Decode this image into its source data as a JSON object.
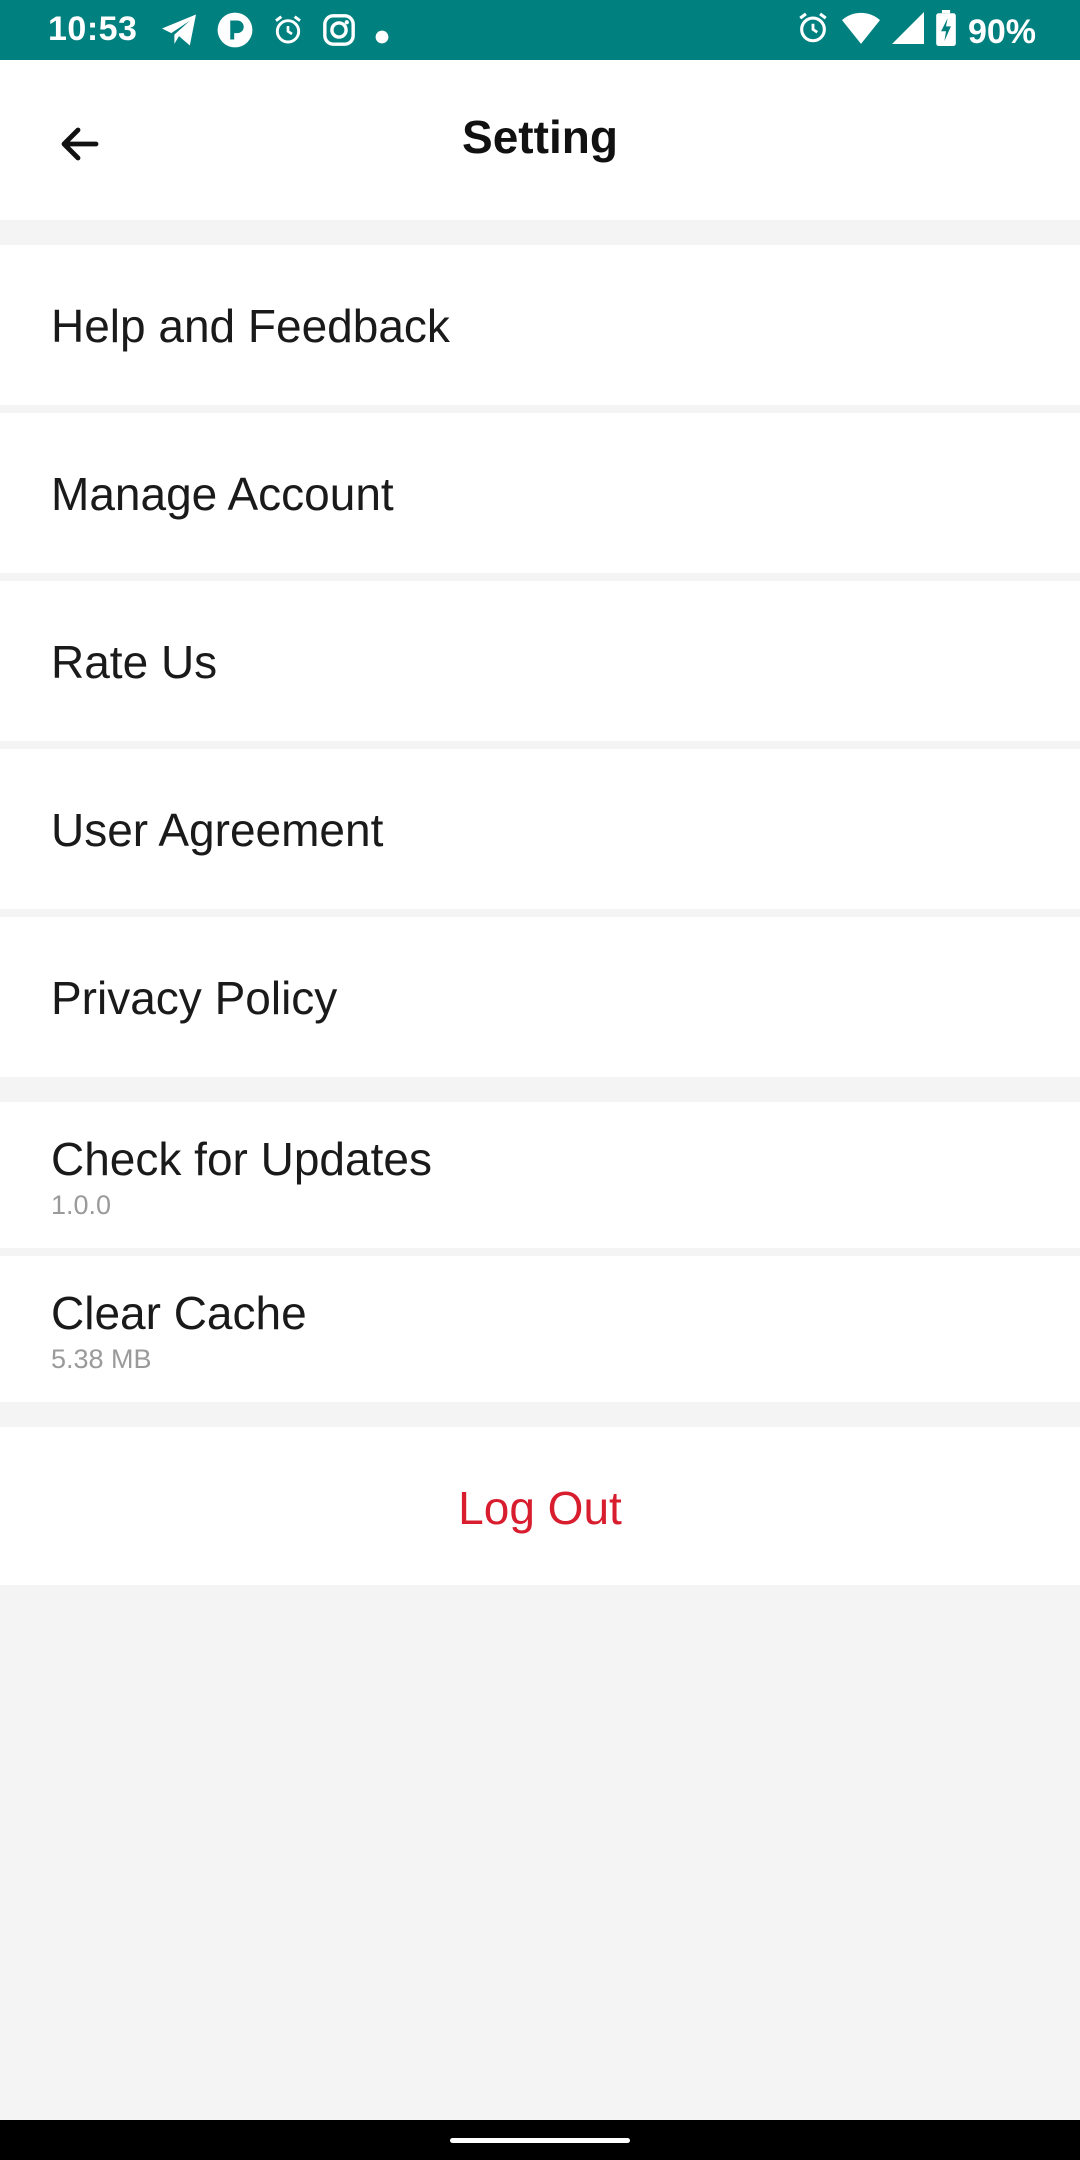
{
  "status_bar": {
    "time": "10:53",
    "battery": "90%",
    "left_icons": [
      "telegram-icon",
      "app-p-icon",
      "alarm-icon",
      "instagram-icon",
      "dot-icon"
    ],
    "right_icons": [
      "alarm-icon",
      "wifi-icon",
      "signal-icon",
      "battery-charging-icon"
    ],
    "background_color": "#00807f"
  },
  "header": {
    "title": "Setting",
    "back_icon": "arrow-left-icon"
  },
  "settings": {
    "items": [
      {
        "label": "Help and Feedback"
      },
      {
        "label": "Manage Account"
      },
      {
        "label": "Rate Us"
      },
      {
        "label": "User Agreement"
      },
      {
        "label": "Privacy Policy"
      }
    ],
    "updates": {
      "label": "Check for Updates",
      "sub": "1.0.0"
    },
    "cache": {
      "label": "Clear Cache",
      "sub": "5.38 MB"
    },
    "logout": {
      "label": "Log Out",
      "color": "#d81e2e"
    }
  }
}
